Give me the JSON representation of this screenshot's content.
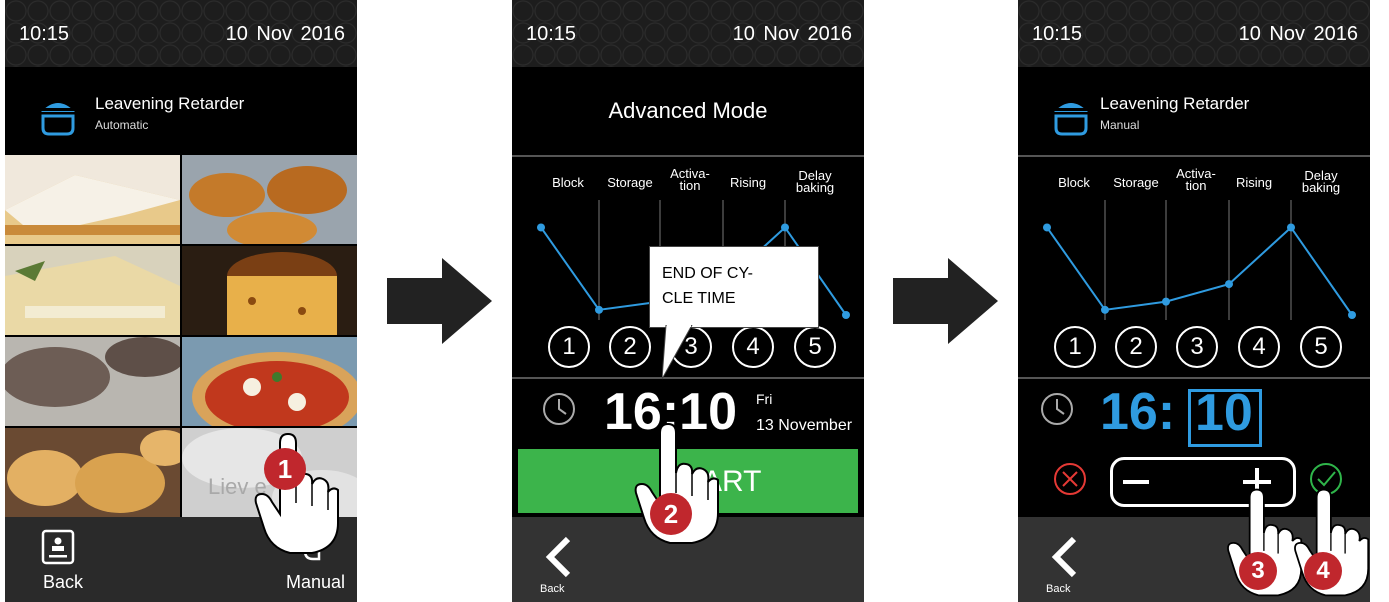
{
  "status": {
    "time": "10:15",
    "date": "10 Nov 2016"
  },
  "screen1": {
    "title": "Leavening Retarder",
    "subtitle": "Automatic",
    "tile_label": "Liev     e",
    "back_label": "Back",
    "manual_label": "Manual",
    "step_number": "1"
  },
  "screen2": {
    "header_title": "Advanced Mode",
    "phases": [
      "Block",
      "Storage",
      "Activa-|tion",
      "Rising",
      "Delay|baking"
    ],
    "phase_numbers": [
      "1",
      "2",
      "3",
      "4",
      "5"
    ],
    "tooltip_line1": "END OF CY-",
    "tooltip_line2": "CLE TIME",
    "end_time": "16:10",
    "end_day": "Fri",
    "end_date": "13 November",
    "start_button": "ART",
    "back_label": "Back",
    "step_number": "2"
  },
  "screen3": {
    "title": "Leavening Retarder",
    "subtitle": "Manual",
    "phases": [
      "Block",
      "Storage",
      "Activa-|tion",
      "Rising",
      "Delay|baking"
    ],
    "phase_numbers": [
      "1",
      "2",
      "3",
      "4",
      "5"
    ],
    "time_hours": "16:",
    "time_minutes": "10",
    "back_label": "Back",
    "step_numbers": [
      "3",
      "4"
    ]
  },
  "chart_data": [
    {
      "type": "line",
      "categories": [
        "Block",
        "Storage",
        "Activation",
        "Rising",
        "Delay baking"
      ],
      "values": [
        0.85,
        0.05,
        0.13,
        0.3,
        0.85,
        0.0
      ]
    },
    {
      "type": "line",
      "categories": [
        "Block",
        "Storage",
        "Activation",
        "Rising",
        "Delay baking"
      ],
      "values": [
        0.85,
        0.05,
        0.13,
        0.3,
        0.85,
        0.0
      ]
    }
  ],
  "colors": {
    "accent_blue": "#2f9be0",
    "start_green": "#3cb44b",
    "marker_red": "#c0272d",
    "ok_green": "#2fb54a",
    "cancel_red": "#e53935"
  },
  "icons": [
    "app-icon",
    "tile-image",
    "back-icon",
    "hand-pointer-icon",
    "clock-icon",
    "chevron-left-icon",
    "cancel-icon",
    "confirm-icon",
    "arrow-right-icon",
    "minus-icon",
    "plus-icon"
  ]
}
